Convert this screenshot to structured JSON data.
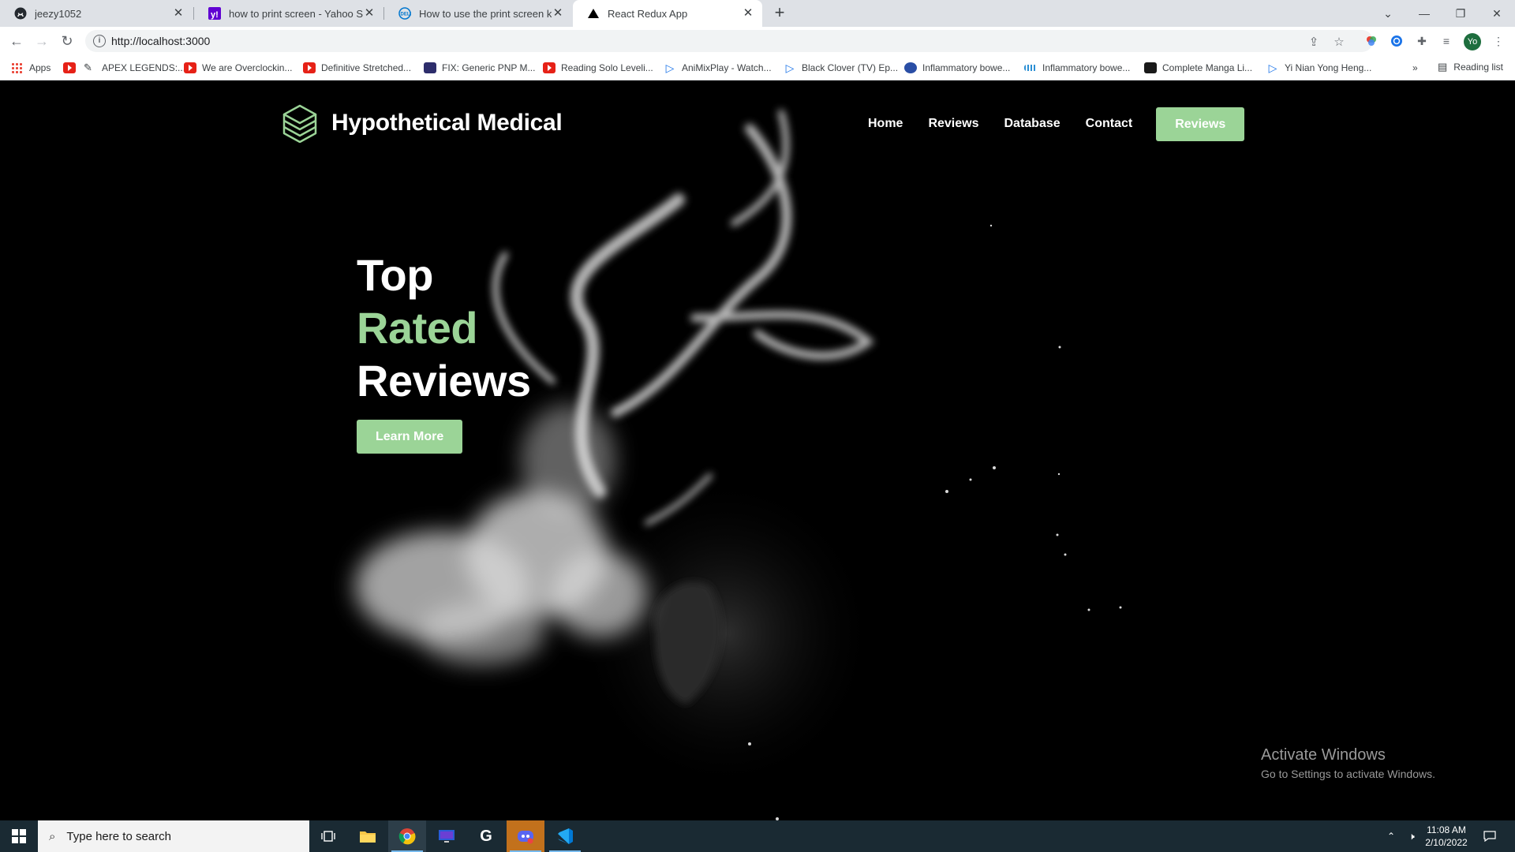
{
  "browser": {
    "tabs": [
      {
        "title": "jeezy1052",
        "icon": "github-icon",
        "active": false
      },
      {
        "title": "how to print screen - Yahoo Sear",
        "icon": "yahoo-icon",
        "active": false
      },
      {
        "title": "How to use the print screen key",
        "icon": "dell-icon",
        "active": false
      },
      {
        "title": "React Redux App",
        "icon": "vercel-icon",
        "active": true
      }
    ],
    "url": "http://localhost:3000",
    "profile_initials": "Yo",
    "bookmarks": [
      {
        "label": "Apps",
        "icon": "apps-grid-icon"
      },
      {
        "label": "",
        "icon": "youtube-icon"
      },
      {
        "label": "APEX LEGENDS:...",
        "icon": "pencil-icon"
      },
      {
        "label": "We are Overclockin...",
        "icon": "youtube-icon"
      },
      {
        "label": "Definitive Stretched...",
        "icon": "youtube-icon"
      },
      {
        "label": "FIX: Generic PNP M...",
        "icon": "site-icon"
      },
      {
        "label": "Reading Solo Leveli...",
        "icon": "youtube-icon"
      },
      {
        "label": "AniMixPlay - Watch...",
        "icon": "animix-icon"
      },
      {
        "label": "Black Clover (TV) Ep...",
        "icon": "animix-icon"
      },
      {
        "label": "Inflammatory bowe...",
        "icon": "globe-icon"
      },
      {
        "label": "Inflammatory bowe...",
        "icon": "site-icon"
      },
      {
        "label": "Complete Manga Li...",
        "icon": "manga-icon"
      },
      {
        "label": "Yi Nian Yong Heng...",
        "icon": "animix-icon"
      }
    ],
    "overflow_label": "»",
    "reading_list_label": "Reading list"
  },
  "site": {
    "brand": "Hypothetical Medical",
    "nav": [
      "Home",
      "Reviews",
      "Database",
      "Contact"
    ],
    "nav_cta": "Reviews",
    "hero": {
      "line1": "Top",
      "line2": "Rated",
      "line3": "Reviews",
      "button": "Learn More"
    },
    "accent_color": "#9bd497"
  },
  "watermark": {
    "title": "Activate Windows",
    "subtitle": "Go to Settings to activate Windows."
  },
  "taskbar": {
    "search_placeholder": "Type here to search",
    "time": "11:08 AM",
    "date": "2/10/2022"
  }
}
